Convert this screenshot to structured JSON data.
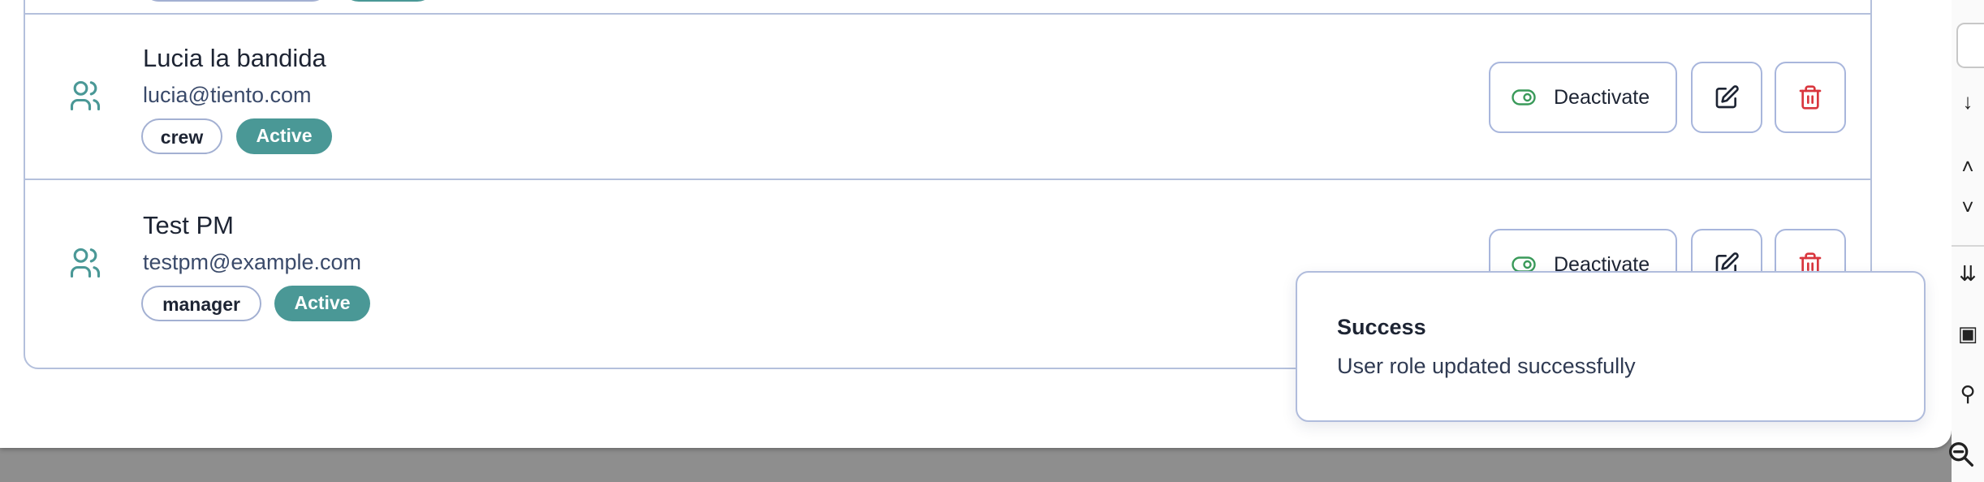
{
  "users": [
    {
      "name": "",
      "email": "",
      "role": "",
      "status": "",
      "partial": true
    },
    {
      "name": "Lucia la bandida",
      "email": "lucia@tiento.com",
      "role": "crew",
      "status": "Active",
      "actions": {
        "toggle_label": "Deactivate"
      }
    },
    {
      "name": "Test PM",
      "email": "testpm@example.com",
      "role": "manager",
      "status": "Active",
      "actions": {
        "toggle_label": "Deactivate"
      }
    }
  ],
  "toast": {
    "title": "Success",
    "message": "User role updated successfully"
  },
  "colors": {
    "accent": "#4a9896",
    "border": "#b4c0dc",
    "toggle_green": "#3a9a5a",
    "delete_red": "#d9363e"
  },
  "icons": {
    "row": "users-icon",
    "toggle": "toggle-on-icon",
    "edit": "edit-icon",
    "delete": "trash-icon",
    "zoom": "zoom-out-icon"
  }
}
